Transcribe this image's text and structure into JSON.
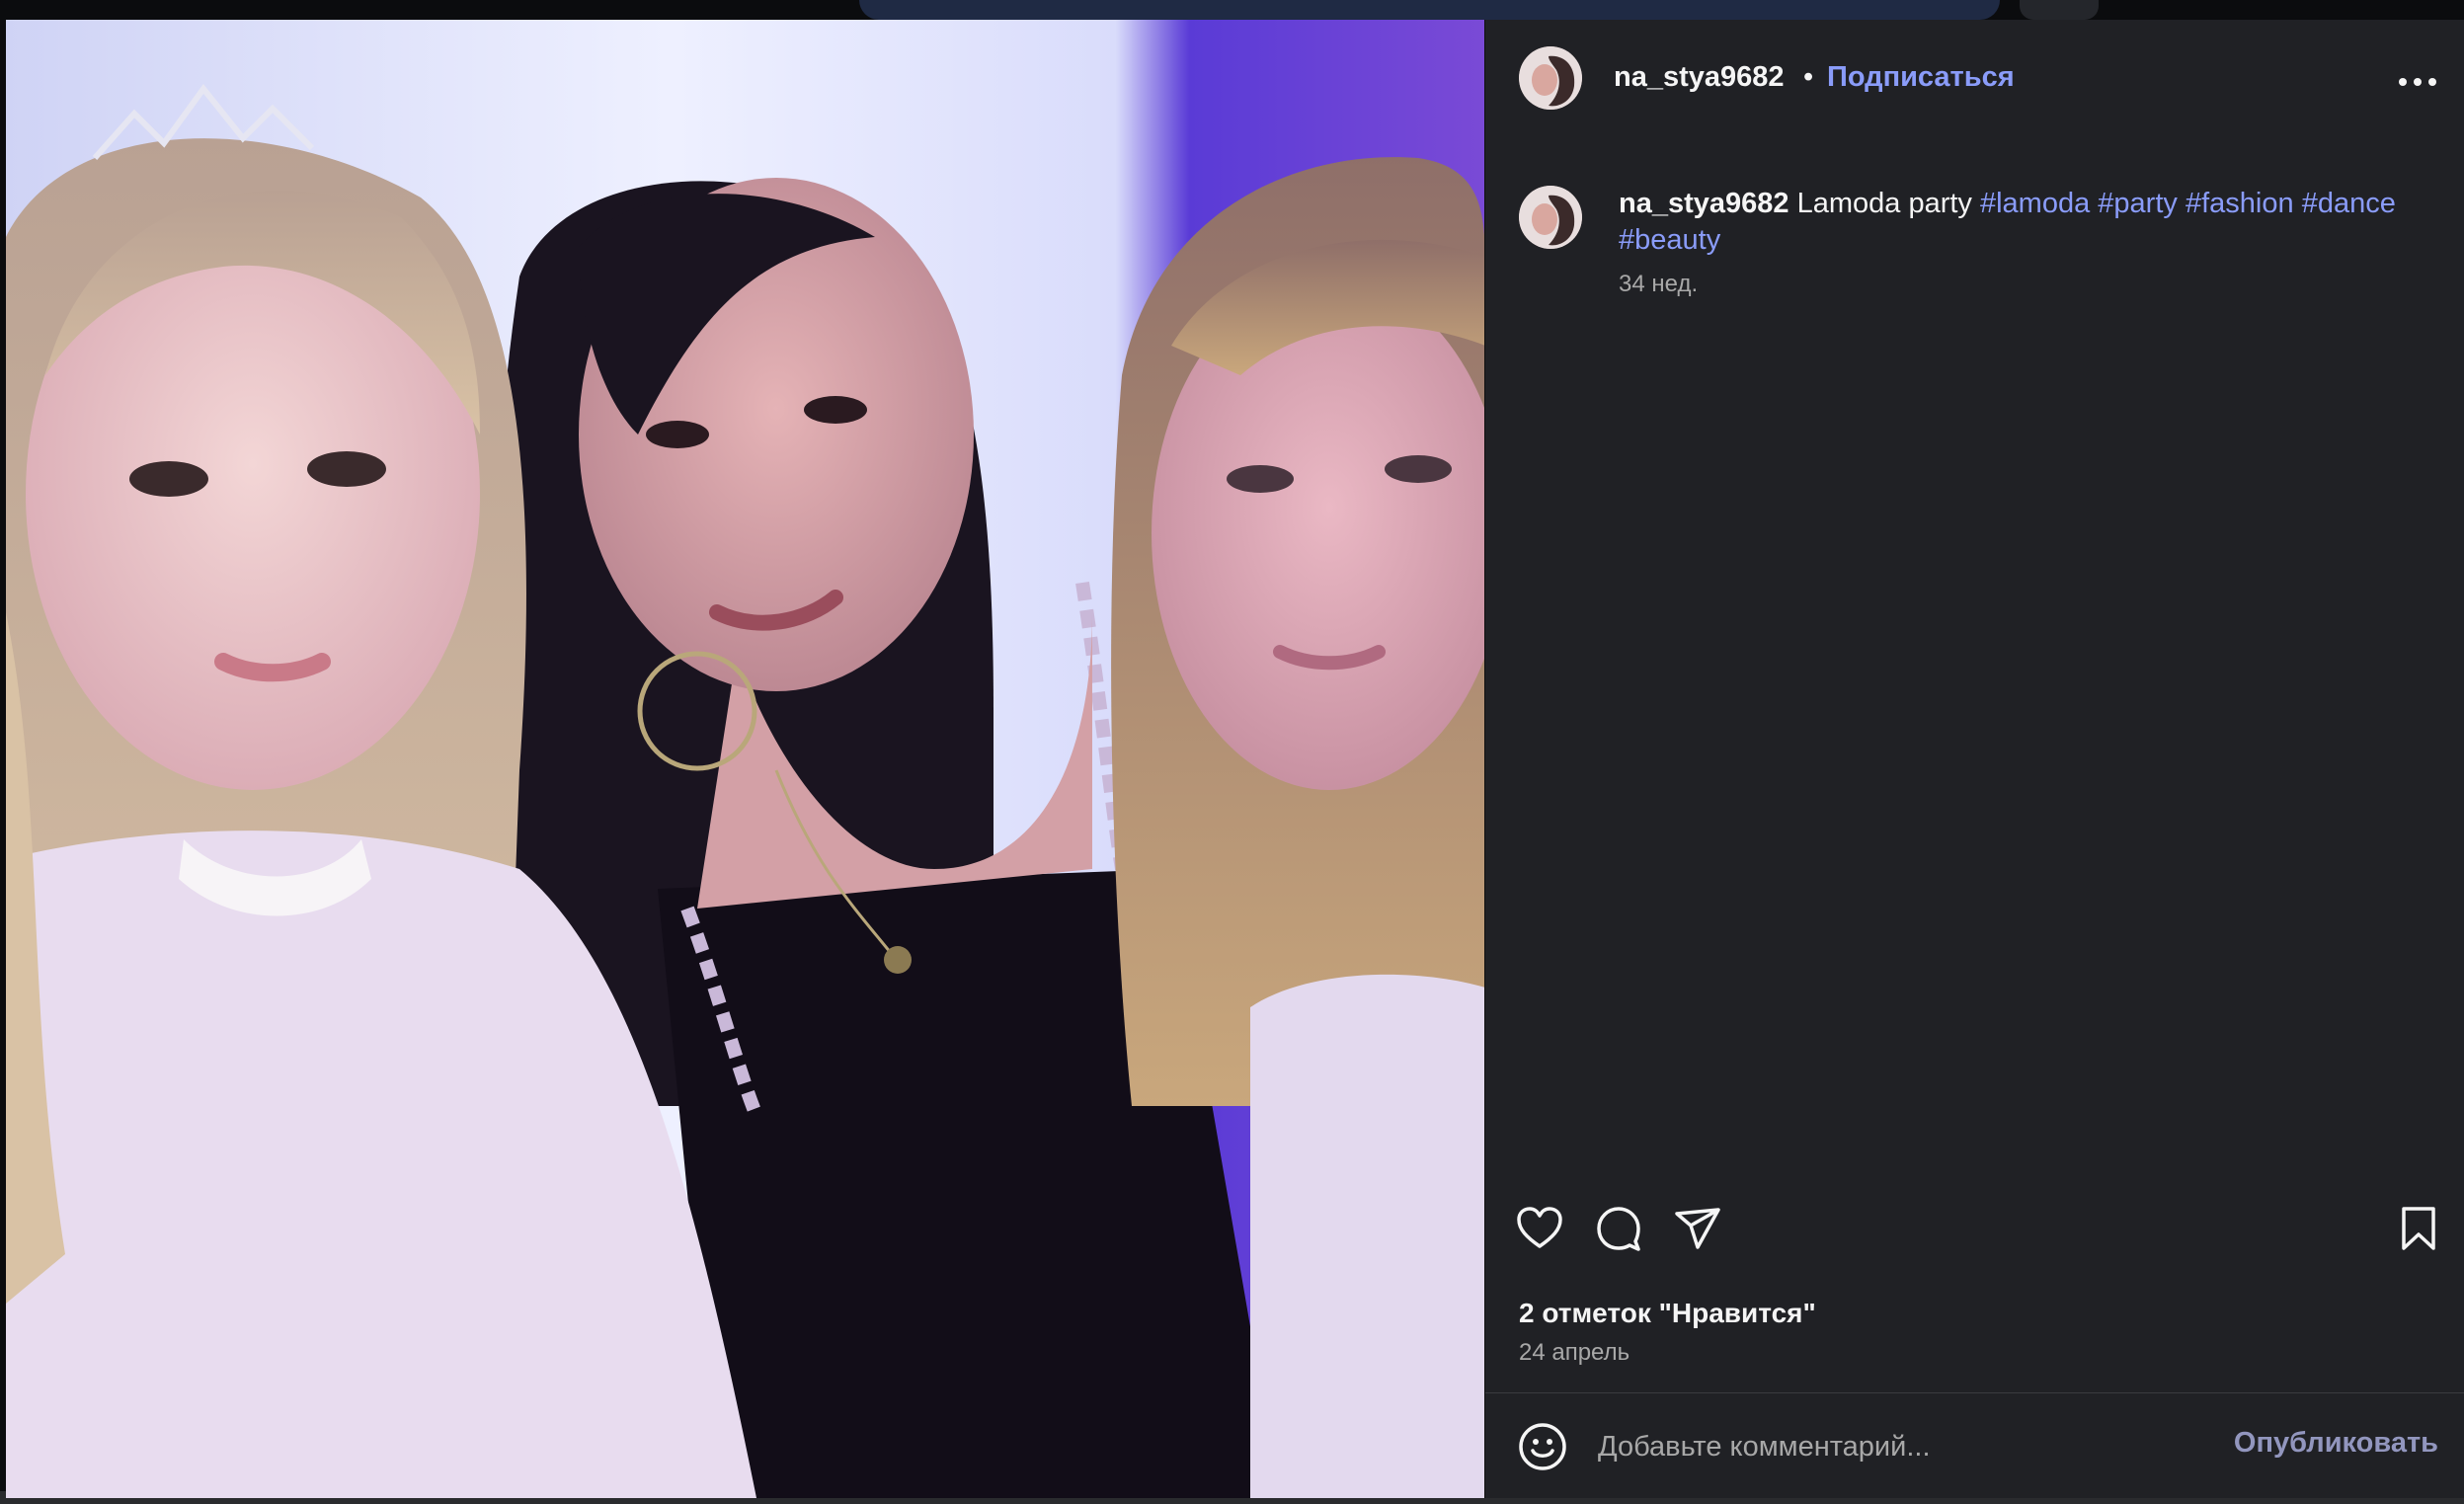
{
  "post": {
    "author": "na_stya9682",
    "separator": "•",
    "follow_label": "Подписаться",
    "more_icon": "more-horizontal-icon",
    "photo_description_icon": "photo"
  },
  "caption": {
    "author": "na_stya9682",
    "text": " Lamoda party ",
    "hashtags": [
      "#lamoda",
      "#party",
      "#fashion",
      "#dance",
      "#beauty"
    ],
    "time": "34 нед."
  },
  "actions": {
    "like_icon": "heart-icon",
    "comment_icon": "comment-icon",
    "share_icon": "share-icon",
    "save_icon": "bookmark-icon"
  },
  "likes": "2 отметок \"Нравится\"",
  "date": "24 апрель",
  "comment": {
    "emoji_icon": "emoji-icon",
    "placeholder": "Добавьте комментарий...",
    "value": "",
    "publish_label": "Опубликовать"
  },
  "colors": {
    "panel_bg": "#202125",
    "accent_link": "#8a9cf9",
    "muted_text": "#a8a8a8",
    "primary_text": "#f5f5f5"
  }
}
